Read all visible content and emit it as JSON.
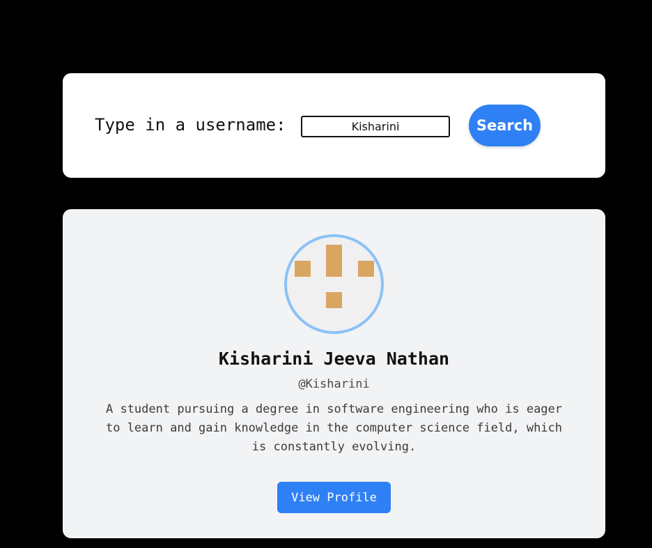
{
  "search": {
    "label": "Type in a username:",
    "input_value": "Kisharini",
    "button_label": "Search"
  },
  "profile": {
    "name": "Kisharini Jeeva Nathan",
    "handle": "@Kisharini",
    "bio": "A student pursuing a degree in software engineering who is eager to learn and gain knowledge in the computer science field, which is constantly evolving.",
    "button_label": "View Profile",
    "avatar_icon": "identicon-avatar"
  },
  "colors": {
    "page_background": "#000000",
    "accent": "#2f80f5",
    "avatar_border": "#8cc1f7",
    "identicon": "#d9a662",
    "profile_card": "#f2f3f5"
  }
}
